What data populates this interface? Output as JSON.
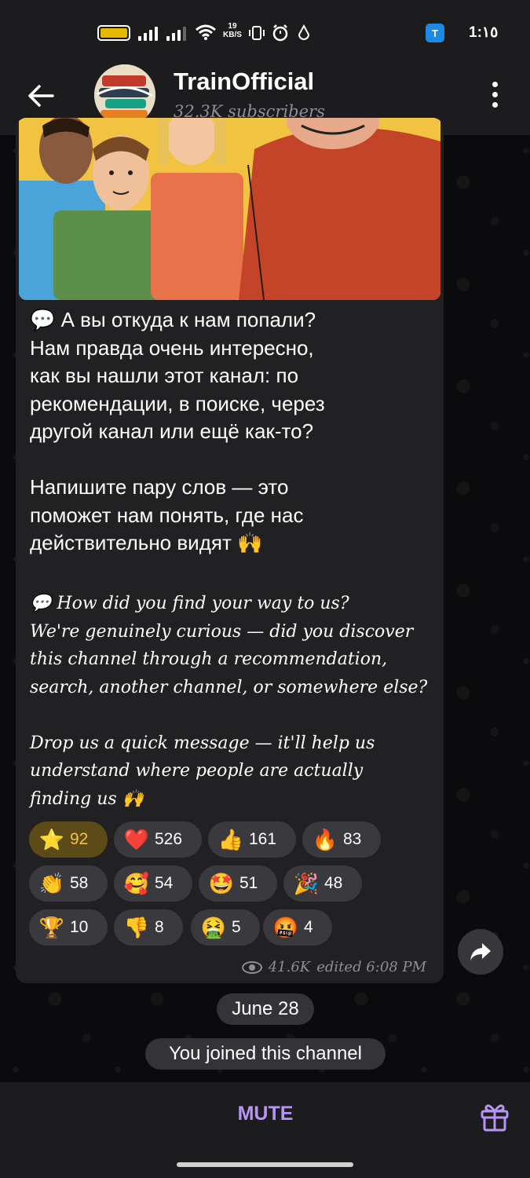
{
  "status_bar": {
    "network_speed_value": "19",
    "network_speed_unit": "KB/S",
    "time": "1:١٥",
    "app_badge": "T"
  },
  "header": {
    "title": "TrainOfficial",
    "subscribers": "32.3K subscribers"
  },
  "message": {
    "text_ru": "💬 А вы откуда к нам попали?\nНам правда очень интересно,\nкак вы нашли этот канал: по\nрекомендации, в поиске, через\nдругой канал или ещё как-то?\n\nНапишите пару слов — это\nпоможет нам понять, где нас\nдействительно видят 🙌",
    "text_en": "💬 How did you find your way to us?\nWe're genuinely curious — did you discover\nthis channel through a recommendation,\nsearch, another channel, or somewhere else?\n\nDrop us a quick message — it'll help us\nunderstand where people are actually\nfinding us 🙌",
    "views": "41.6K",
    "edited": "edited 6:08 PM"
  },
  "reactions": [
    {
      "emoji": "⭐",
      "count": "92",
      "active": true
    },
    {
      "emoji": "❤️",
      "count": "526"
    },
    {
      "emoji": "👍",
      "count": "161"
    },
    {
      "emoji": "🔥",
      "count": "83"
    },
    {
      "emoji": "👏",
      "count": "58"
    },
    {
      "emoji": "🥰",
      "count": "54"
    },
    {
      "emoji": "🤩",
      "count": "51"
    },
    {
      "emoji": "🎉",
      "count": "48"
    },
    {
      "emoji": "🏆",
      "count": "10"
    },
    {
      "emoji": "👎",
      "count": "8"
    },
    {
      "emoji": "🤮",
      "count": "5"
    },
    {
      "emoji": "🤬",
      "count": "4"
    }
  ],
  "date_separator": "June 28",
  "service_message": "You joined this channel",
  "bottom_bar": {
    "mute_label": "MUTE"
  },
  "colors": {
    "accent": "#b794f6",
    "bubble": "#212124",
    "star_reaction": "#f5c242"
  },
  "icons": [
    "back-arrow-icon",
    "more-vert-icon",
    "eye-icon",
    "share-icon",
    "gift-icon",
    "wifi-icon",
    "vibrate-icon",
    "alarm-icon",
    "drop-icon"
  ]
}
